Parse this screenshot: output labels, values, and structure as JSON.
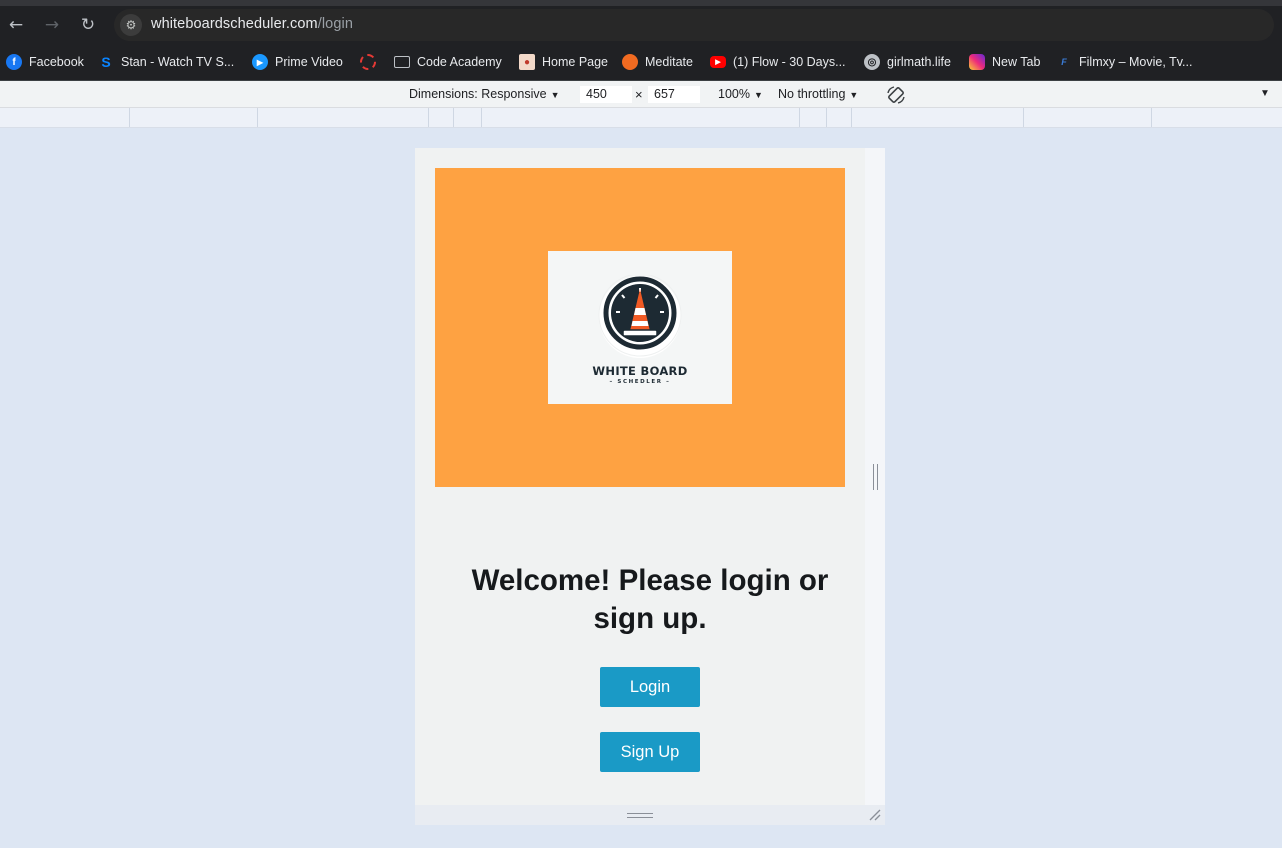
{
  "browser": {
    "url_domain": "whiteboardscheduler.com",
    "url_path": "/login",
    "nav": {
      "back_icon": "arrow-left-icon",
      "forward_icon": "arrow-right-icon",
      "reload_icon": "reload-icon"
    }
  },
  "bookmarks": [
    {
      "label": "Facebook",
      "icon": "facebook-icon",
      "color": "#1877f2"
    },
    {
      "label": "Stan - Watch TV S...",
      "icon": "stan-icon",
      "color": "#0a84ff"
    },
    {
      "label": "Prime Video",
      "icon": "prime-video-icon",
      "color": "#1a98ff"
    },
    {
      "label": "",
      "icon": "dashed-circle-icon",
      "color": "#e53935"
    },
    {
      "label": "Code Academy",
      "icon": "folder-icon",
      "color": "#bdc1c6"
    },
    {
      "label": "Home Page",
      "icon": "avatar-icon",
      "color": "#c0392b"
    },
    {
      "label": "Meditate",
      "icon": "orange-circle-icon",
      "color": "#f26b21"
    },
    {
      "label": "(1) Flow - 30 Days...",
      "icon": "youtube-icon",
      "color": "#ff0000"
    },
    {
      "label": "girlmath.life",
      "icon": "globe-icon",
      "color": "#bdc1c6"
    },
    {
      "label": "New Tab",
      "icon": "instagram-icon",
      "color": "#d6249f"
    },
    {
      "label": "Filmxy – Movie, Tv...",
      "icon": "filmxy-icon",
      "color": "#3a7bd5"
    }
  ],
  "devtools": {
    "dimensions_label": "Dimensions: Responsive",
    "width": "450",
    "times": "×",
    "height": "657",
    "zoom": "100%",
    "throttling": "No throttling"
  },
  "page": {
    "logo_title": "WHITE BOARD",
    "logo_subtitle": "– SCHEDLER –",
    "heading": "Welcome! Please login or sign up.",
    "login_label": "Login",
    "signup_label": "Sign Up"
  },
  "colors": {
    "hero": "#fea242",
    "button": "#1a9ac6",
    "cone": "#f15a24"
  }
}
